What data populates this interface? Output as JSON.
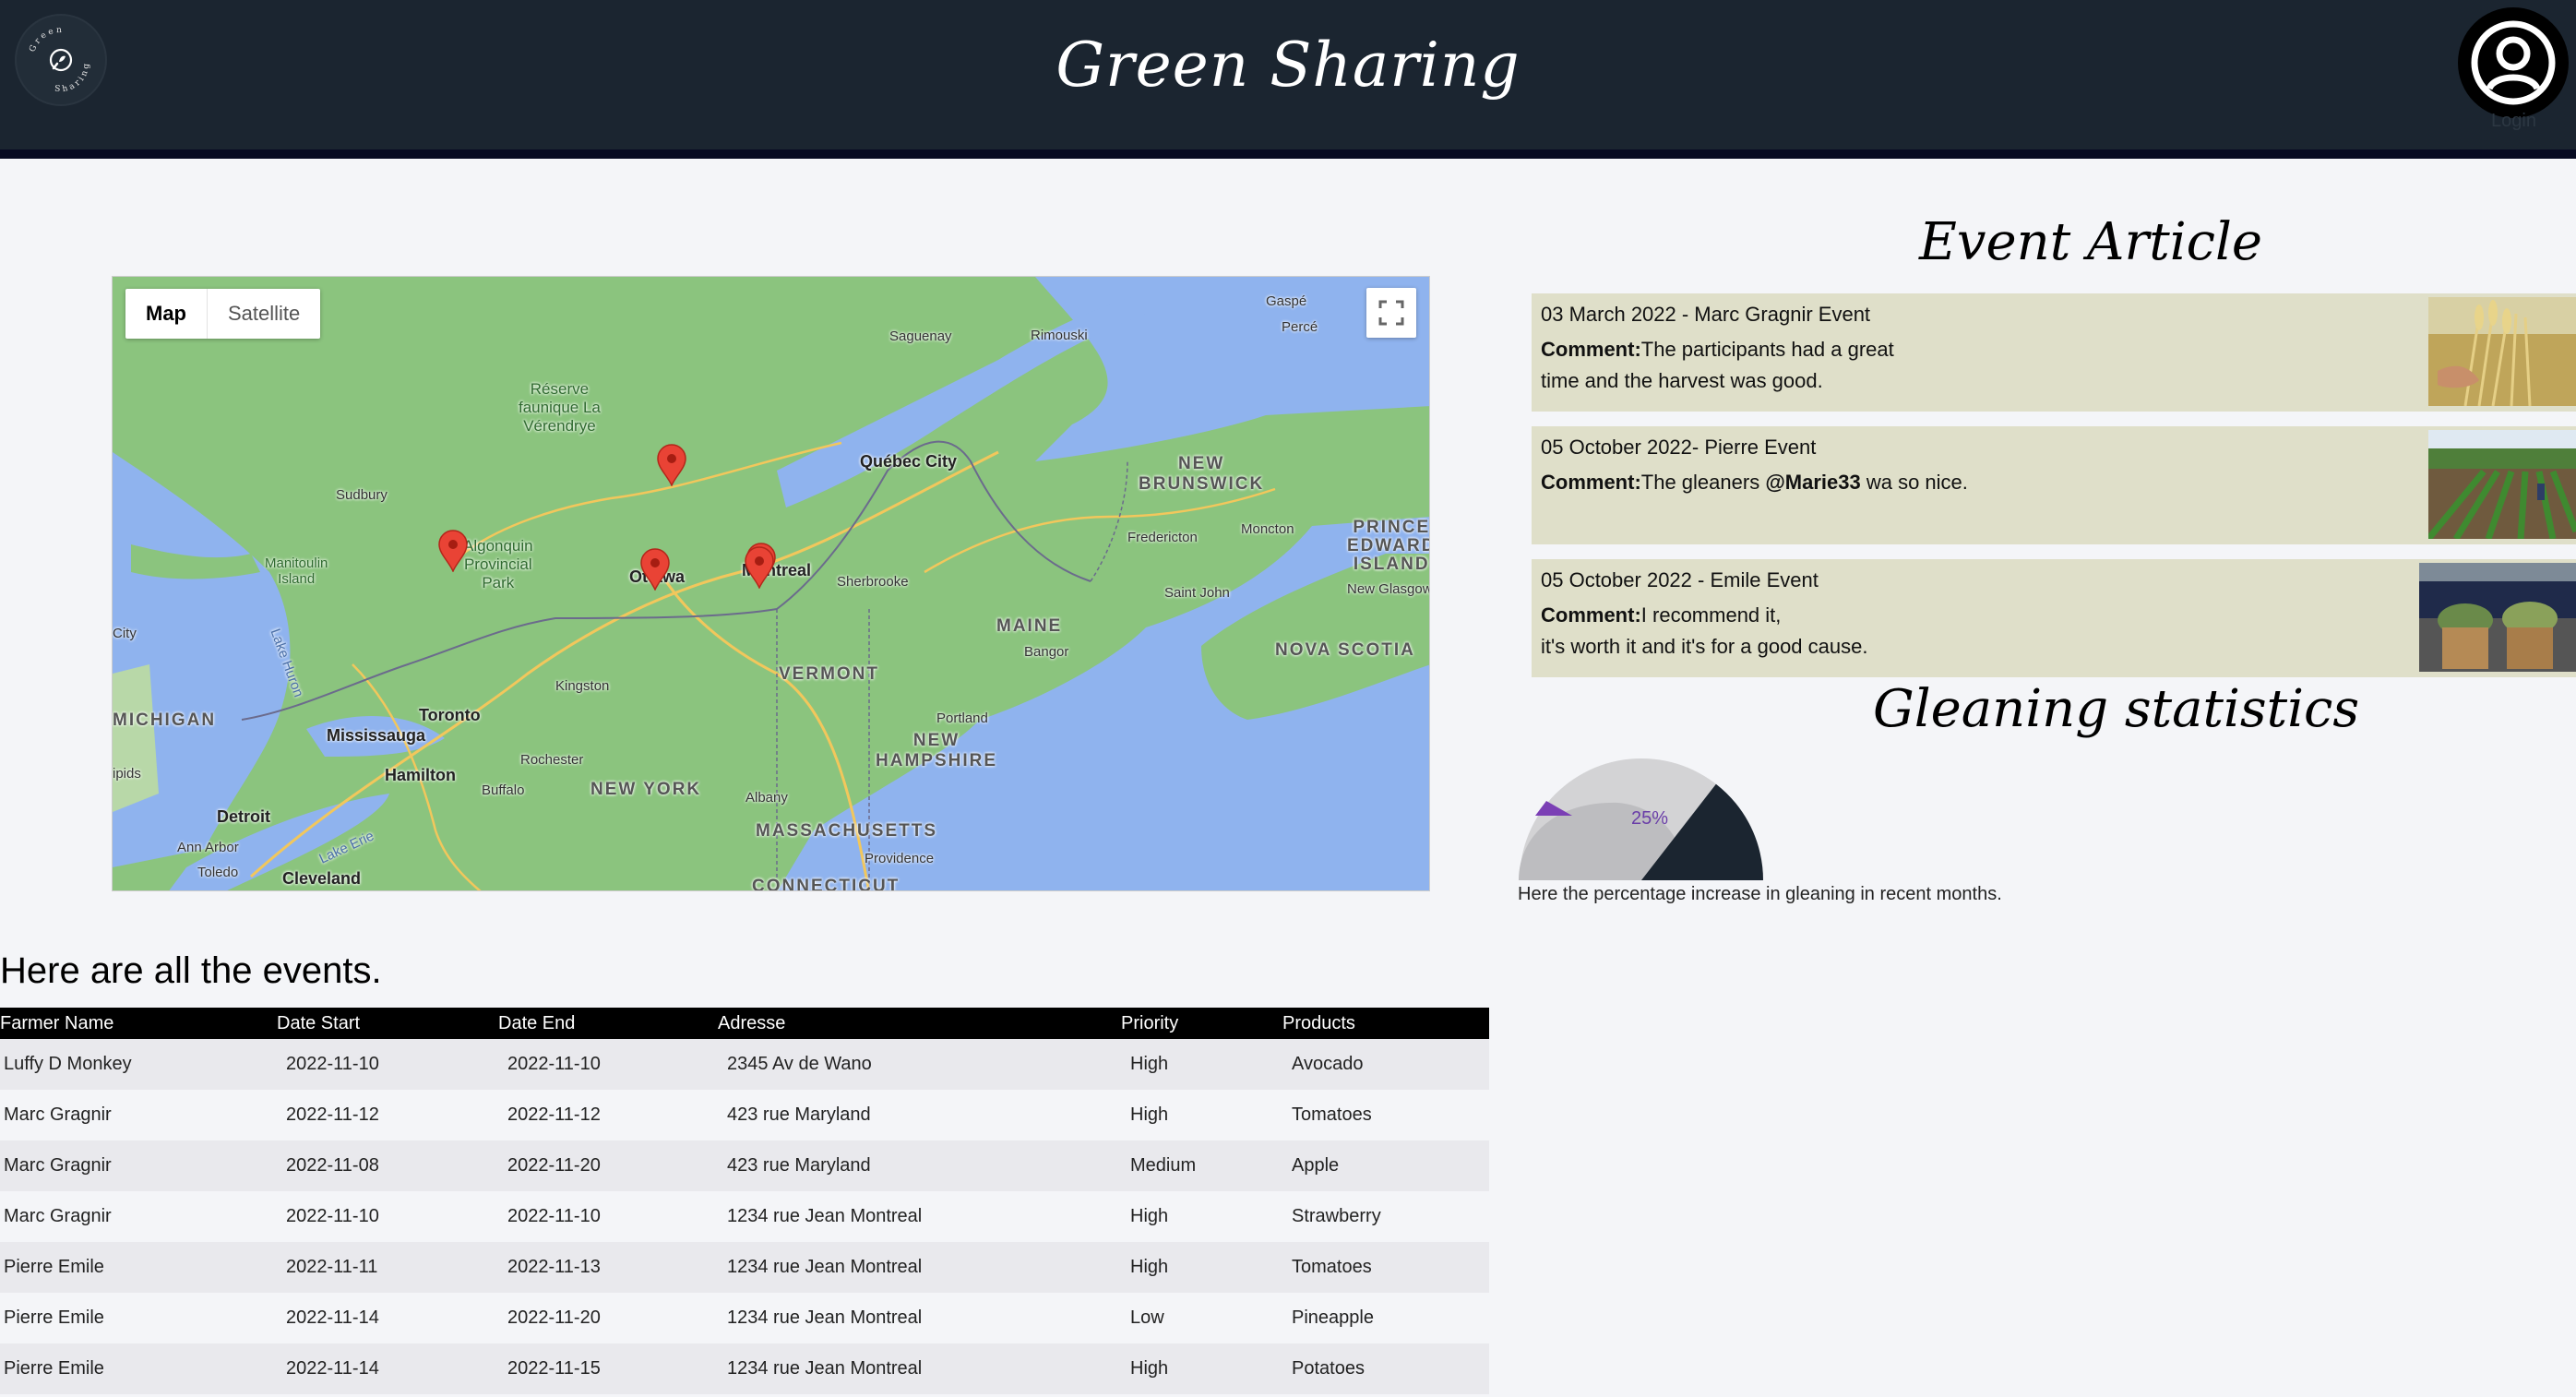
{
  "header": {
    "logo_text_top": "Green",
    "logo_text_bottom": "Sharing",
    "title": "Green Sharing",
    "login_label": "Login"
  },
  "map": {
    "type_controls": [
      "Map",
      "Satellite"
    ],
    "labels": {
      "gaspe": "Gaspé",
      "perce": "Percé",
      "saguenay": "Saguenay",
      "rimouski": "Rimouski",
      "reserve": "Réserve\nfaunique La\nVérendrye",
      "quebec": "Québec City",
      "new_brunswick": "NEW\nBRUNSWICK",
      "sudbury": "Sudbury",
      "algonquin": "Algonquin\nProvincial\nPark",
      "manitoulin": "Manitoulin\nIsland",
      "ottawa": "Ottawa",
      "montreal": "Montreal",
      "sherbrooke": "Sherbrooke",
      "fredericton": "Fredericton",
      "moncton": "Moncton",
      "pei": "PRINCE\nEDWARD\nISLAND",
      "saint_john": "Saint John",
      "new_glasgow": "New Glasgow",
      "city": "City",
      "lake_huron": "Lake Huron",
      "maine": "MAINE",
      "bangor": "Bangor",
      "nova_scotia": "NOVA SCOTIA",
      "kingston": "Kingston",
      "vermont": "VERMONT",
      "michigan": "MICHIGAN",
      "toronto": "Toronto",
      "mississauga": "Mississauga",
      "portland": "Portland",
      "hamilton": "Hamilton",
      "rochester": "Rochester",
      "new_hampshire": "NEW\nHAMPSHIRE",
      "ipids": "ipids",
      "buffalo": "Buffalo",
      "new_york": "NEW YORK",
      "albany": "Albany",
      "detroit": "Detroit",
      "massachusetts": "MASSACHUSETTS",
      "ann_arbor": "Ann Arbor",
      "providence": "Providence",
      "lake_erie": "Lake Erie",
      "toledo": "Toledo",
      "cleveland": "Cleveland",
      "connecticut": "CONNECTICUT"
    }
  },
  "events": {
    "heading": "Here are all the events.",
    "columns": [
      "Farmer Name",
      "Date Start",
      "Date End",
      "Adresse",
      "Priority",
      "Products"
    ],
    "rows": [
      [
        "Luffy D Monkey",
        "2022-11-10",
        "2022-11-10",
        "2345 Av de Wano",
        "High",
        "Avocado"
      ],
      [
        "Marc Gragnir",
        "2022-11-12",
        "2022-11-12",
        "423 rue Maryland",
        "High",
        "Tomatoes"
      ],
      [
        "Marc Gragnir",
        "2022-11-08",
        "2022-11-20",
        "423 rue Maryland",
        "Medium",
        "Apple"
      ],
      [
        "Marc Gragnir",
        "2022-11-10",
        "2022-11-10",
        "1234 rue Jean Montreal",
        "High",
        "Strawberry"
      ],
      [
        "Pierre Emile",
        "2022-11-11",
        "2022-11-13",
        "1234 rue Jean Montreal",
        "High",
        "Tomatoes"
      ],
      [
        "Pierre Emile",
        "2022-11-14",
        "2022-11-20",
        "1234 rue Jean Montreal",
        "Low",
        "Pineapple"
      ],
      [
        "Pierre Emile",
        "2022-11-14",
        "2022-11-15",
        "1234 rue Jean Montreal",
        "High",
        "Potatoes"
      ]
    ]
  },
  "articles": {
    "heading": "Event Article",
    "comment_label": "Comment:",
    "items": [
      {
        "title": "03 March 2022 - Marc Gragnir Event",
        "comment_line1": "The participants had a great",
        "comment_line2": "time and the harvest was good."
      },
      {
        "title": "05 October 2022- Pierre Event",
        "comment_pre": "The gleaners ",
        "mention": "@Marie33",
        "comment_post": " wa so nice."
      },
      {
        "title": "05 October 2022 - Emile Event",
        "comment_line1": "I recommend it,",
        "comment_line2": "it's worth it and it's for a good cause."
      }
    ]
  },
  "statistics": {
    "heading": "Gleaning statistics",
    "percent_label": "25%",
    "percent_value": 25,
    "caption": "Here the percentage increase in gleaning in recent months.",
    "colors": {
      "dark": "#1b2530",
      "light": "#d3d3d5",
      "mid": "#bdbdc0",
      "accent": "#7b3fb5"
    }
  }
}
